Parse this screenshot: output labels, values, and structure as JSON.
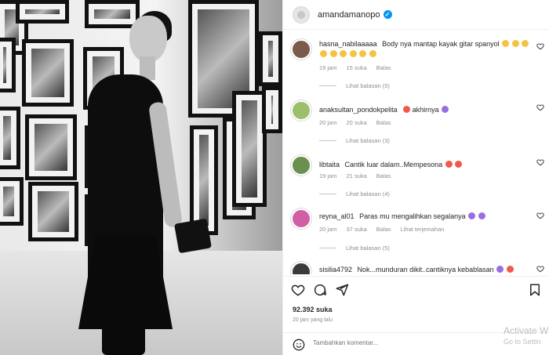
{
  "post": {
    "username": "amandamanopo",
    "likes": "92.392 suka",
    "time_ago": "20 jam yang lalu",
    "add_comment_placeholder": "Tambahkan komentar..."
  },
  "comments": [
    {
      "user": "hasna_nabilaaaaa",
      "text": "Body nya mantap kayak gitar spanyol",
      "time": "19 jam",
      "likes": "15 suka",
      "reply": "Balas",
      "view_replies": "Lihat balasan (5)",
      "avatar_color": "#7a5a4a"
    },
    {
      "user": "anaksultan_pondokpelita",
      "text": "akhirnya",
      "time": "20 jam",
      "likes": "20 suka",
      "reply": "Balas",
      "view_replies": "Lihat balasan (3)",
      "avatar_color": "#9bbf6a"
    },
    {
      "user": "libtaita",
      "text": "Cantik luar dalam..Mempesona",
      "time": "19 jam",
      "likes": "21 suka",
      "reply": "Balas",
      "view_replies": "Lihat balasan (4)",
      "avatar_color": "#6a8f4e"
    },
    {
      "user": "reyna_al01",
      "text": "Paras mu mengalihkan segalanya",
      "time": "20 jam",
      "likes": "37 suka",
      "reply": "Balas",
      "translate": "Lihat terjemahan",
      "view_replies": "Lihat balasan (5)",
      "avatar_color": "#d15fa6"
    },
    {
      "user": "sisilia4792",
      "text": "Nok...munduran dikit..cantiknya kebablasan",
      "avatar_color": "#3a3a3a"
    }
  ],
  "watermark": {
    "line1": "Activate W",
    "line2": "Go to Settin"
  },
  "colors": {
    "verified": "#0095f6",
    "muted": "#8e8e8e",
    "text": "#262626"
  },
  "icons": [
    "heart-icon",
    "comment-icon",
    "share-icon",
    "bookmark-icon",
    "smile-icon",
    "verified-icon",
    "more-options-icon"
  ]
}
